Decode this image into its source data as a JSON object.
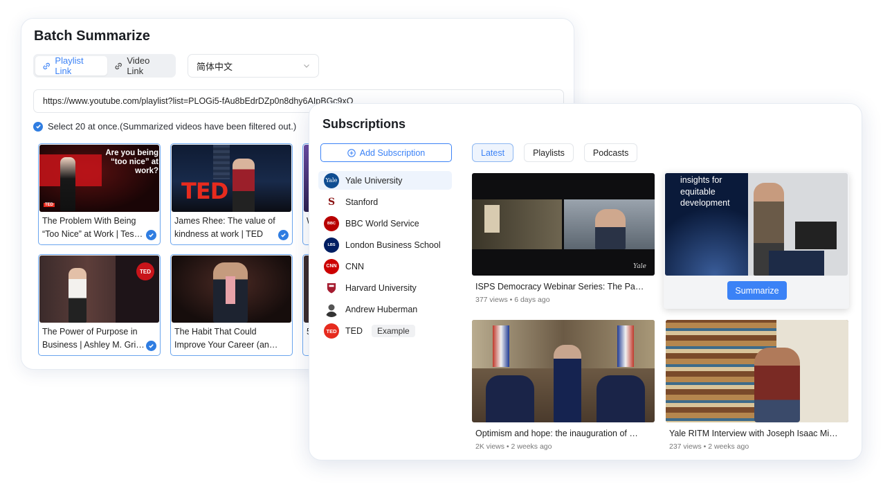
{
  "batch": {
    "title": "Batch Summarize",
    "tabs": [
      {
        "label": "Playlist Link",
        "icon": "link-icon",
        "active": true
      },
      {
        "label": "Video Link",
        "icon": "link-icon",
        "active": false
      }
    ],
    "language": "简体中文",
    "url_value": "https://www.youtube.com/playlist?list=PLOGi5-fAu8bEdrDZp0n8dhy6AIpBGc9xQ",
    "note": "Select 20 at once.(Summarized videos have been filtered out.)",
    "videos": [
      {
        "title": "The Problem With Being “Too Nice” at Work | Tessa West | TED",
        "thumb_text": "Are you being “too nice” at work?",
        "checked": true
      },
      {
        "title": "James Rhee: The value of kindness at work | TED",
        "thumb_text": "TED",
        "checked": true
      },
      {
        "title": "W C",
        "thumb_text": "",
        "checked": false
      },
      {
        "title": "The Power of Purpose in Business | Ashley M. Grice | TED",
        "thumb_text": "TED",
        "checked": true
      },
      {
        "title": "The Habit That Could Improve Your Career (and Life) | TED",
        "thumb_text": "",
        "checked": false
      },
      {
        "title": "5 a",
        "thumb_text": "",
        "checked": false
      }
    ]
  },
  "subs": {
    "title": "Subscriptions",
    "add_label": "Add Subscription",
    "channels": [
      {
        "name": "Yale University",
        "logo_text": "Yale",
        "color": "#0f4d92",
        "active": true
      },
      {
        "name": "Stanford",
        "logo_text": "S",
        "color": "#ffffff",
        "active": false
      },
      {
        "name": "BBC World Service",
        "logo_text": "BBC",
        "color": "#b80000",
        "active": false
      },
      {
        "name": "London Business School",
        "logo_text": "LBS",
        "color": "#001e62",
        "active": false
      },
      {
        "name": "CNN",
        "logo_text": "CNN",
        "color": "#cc0000",
        "active": false
      },
      {
        "name": "Harvard University",
        "logo_text": "H",
        "color": "#ffffff",
        "active": false
      },
      {
        "name": "Andrew Huberman",
        "logo_text": "",
        "color": "#ffffff",
        "active": false
      },
      {
        "name": "TED",
        "logo_text": "TED",
        "color": "#e62b1e",
        "active": false,
        "badge": "Example"
      }
    ],
    "tabs": [
      {
        "label": "Latest",
        "active": true
      },
      {
        "label": "Playlists",
        "active": false
      },
      {
        "label": "Podcasts",
        "active": false
      }
    ],
    "videos": [
      {
        "title": "ISPS Democracy Webinar Series: The Pardon Power",
        "meta": "377 views • 6 days ago",
        "thumb_text": "Yale"
      },
      {
        "title": "Yale Insights for equitable development",
        "meta": "",
        "thumb_text": "insights for equitable development"
      },
      {
        "title": "Optimism and hope: the inauguration of Maurie McInnis",
        "meta": "2K views • 2 weeks ago",
        "thumb_text": ""
      },
      {
        "title": "Yale RITM Interview with Joseph Isaac Miranda",
        "meta": "237 views • 2 weeks ago",
        "thumb_text": ""
      }
    ],
    "summarize_label": "Summarize"
  }
}
